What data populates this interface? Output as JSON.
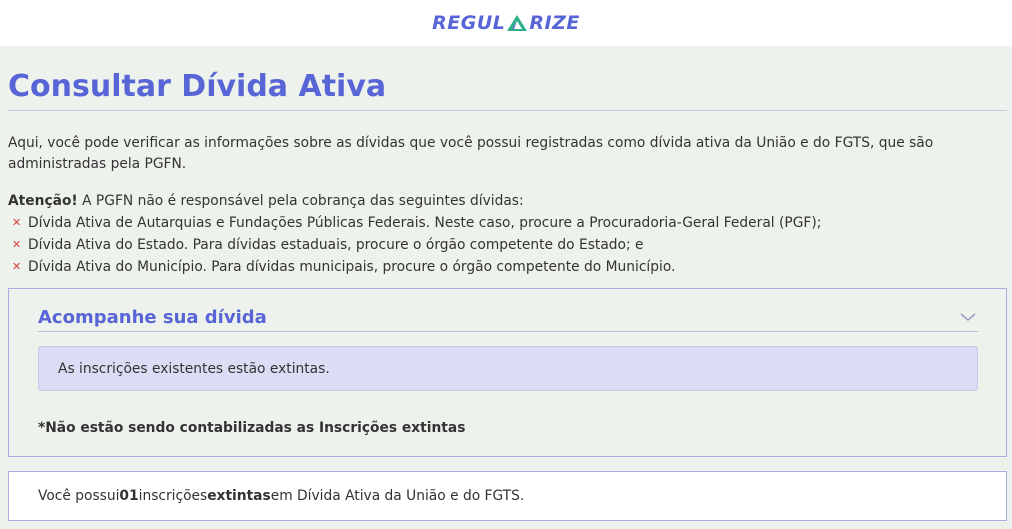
{
  "header": {
    "logo_left": "REGUL",
    "logo_right": "RIZE",
    "logo_color": "#5865d6",
    "logo_accent": "#2fb08a"
  },
  "page": {
    "title": "Consultar Dívida Ativa",
    "intro": "Aqui, você pode verificar as informações sobre as dívidas que você possui registradas como dívida ativa da União e do FGTS, que são administradas pela PGFN.",
    "warning_label": "Atenção!",
    "warning_text": " A PGFN não é responsável pela cobrança das seguintes dívidas:",
    "warning_items": [
      "Dívida Ativa de Autarquias e Fundações Públicas Federais. Neste caso, procure a Procuradoria-Geral Federal (PGF);",
      "Dívida Ativa do Estado. Para dívidas estaduais, procure o órgão competente do Estado; e",
      "Dívida Ativa do Município. Para dívidas municipais, procure o órgão competente do Município."
    ],
    "bullet_icon": "x-mark-icon",
    "accent_color": "#5865d6",
    "bullet_color": "#d0453d"
  },
  "panel": {
    "title": "Acompanhe sua dívida",
    "toggle_icon": "chevron-down-icon",
    "notice": "As inscrições existentes estão extintas.",
    "footnote": "*Não estão sendo contabilizadas as Inscrições extintas"
  },
  "summary": {
    "prefix": "Você possui ",
    "count": "01",
    "middle": " inscrições ",
    "status": "extintas",
    "suffix": " em Dívida Ativa da União e do FGTS."
  }
}
